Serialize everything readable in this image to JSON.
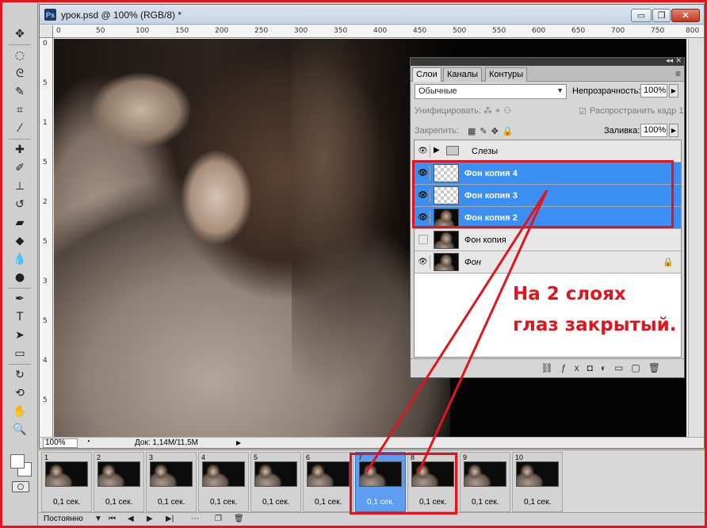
{
  "document": {
    "title": "урок.psd @ 100% (RGB/8) *",
    "zoom": "100%",
    "doc_size": "Док: 1,14M/11,5M",
    "ruler_top_ticks": [
      "0",
      "50",
      "100",
      "150",
      "200",
      "250",
      "300",
      "350",
      "400",
      "450",
      "500",
      "550",
      "600",
      "650",
      "700",
      "750",
      "800"
    ],
    "ruler_left_ticks": [
      "0",
      "5",
      "1",
      "5",
      "2",
      "5",
      "3",
      "5",
      "4",
      "5"
    ]
  },
  "window_buttons": {
    "minimize": "▭",
    "restore": "❐",
    "close": "✕"
  },
  "layers_panel": {
    "tabs": [
      "Слои",
      "Каналы",
      "Контуры"
    ],
    "blend_mode": "Обычные",
    "opacity_label": "Непрозрачность:",
    "opacity_value": "100%",
    "unify_label": "Унифицировать:",
    "propagate_label": "Распространить кадр 1",
    "lock_label": "Закрепить:",
    "fill_label": "Заливка:",
    "fill_value": "100%",
    "layers": [
      {
        "name": "Слезы",
        "type": "group",
        "visible": true,
        "selected": false
      },
      {
        "name": "Фон копия 4",
        "type": "transparent",
        "visible": true,
        "selected": true
      },
      {
        "name": "Фон копия 3",
        "type": "transparent",
        "visible": true,
        "selected": true
      },
      {
        "name": "Фон копия 2",
        "type": "photo",
        "visible": true,
        "selected": true
      },
      {
        "name": "Фон копия",
        "type": "photo",
        "visible": false,
        "selected": false
      },
      {
        "name": "Фон",
        "type": "photo",
        "visible": true,
        "selected": false,
        "locked": true
      }
    ]
  },
  "annotation": {
    "line1": "На 2 слоях",
    "line2": "глаз закрытый.",
    "color": "#e0151d"
  },
  "animation": {
    "frames": [
      {
        "num": "1",
        "time": "0,1 сек."
      },
      {
        "num": "2",
        "time": "0,1 сек."
      },
      {
        "num": "3",
        "time": "0,1 сек."
      },
      {
        "num": "4",
        "time": "0,1 сек."
      },
      {
        "num": "5",
        "time": "0,1 сек."
      },
      {
        "num": "6",
        "time": "0,1 сек."
      },
      {
        "num": "7",
        "time": "0,1 сек."
      },
      {
        "num": "8",
        "time": "0,1 сек."
      },
      {
        "num": "9",
        "time": "0,1 сек."
      },
      {
        "num": "10",
        "time": "0,1 сек."
      }
    ],
    "selected_frame": 7,
    "loop": "Постоянно"
  },
  "colors": {
    "selection": "#3b8ff2",
    "accent_red": "#e0151d"
  }
}
